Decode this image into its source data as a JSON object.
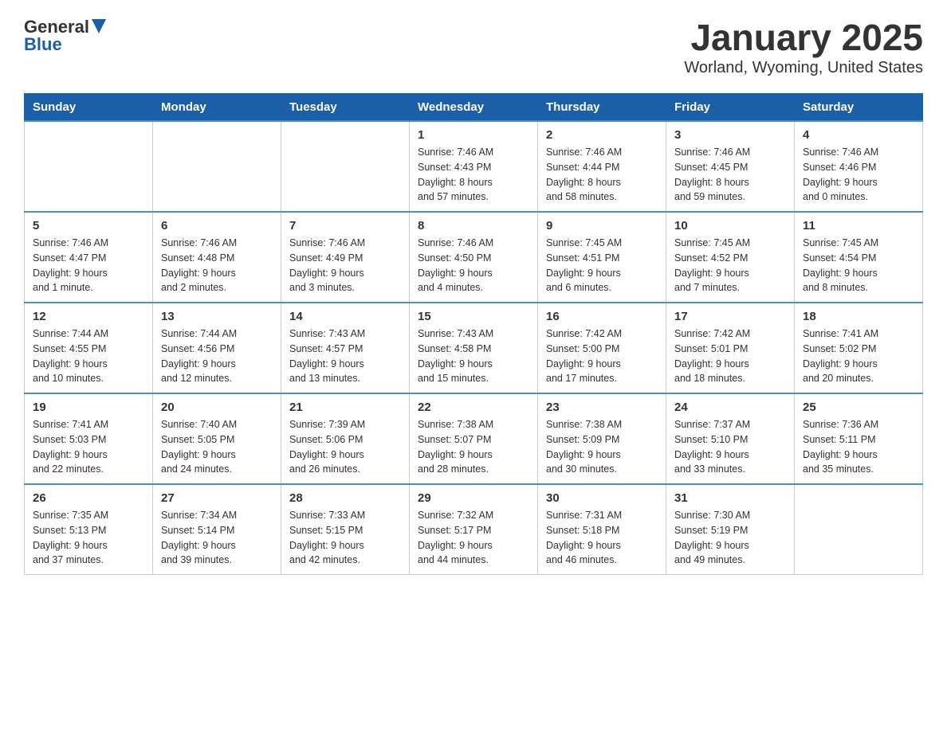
{
  "logo": {
    "general": "General",
    "blue": "Blue"
  },
  "title": "January 2025",
  "subtitle": "Worland, Wyoming, United States",
  "days_of_week": [
    "Sunday",
    "Monday",
    "Tuesday",
    "Wednesday",
    "Thursday",
    "Friday",
    "Saturday"
  ],
  "weeks": [
    [
      {
        "day": "",
        "info": ""
      },
      {
        "day": "",
        "info": ""
      },
      {
        "day": "",
        "info": ""
      },
      {
        "day": "1",
        "info": "Sunrise: 7:46 AM\nSunset: 4:43 PM\nDaylight: 8 hours\nand 57 minutes."
      },
      {
        "day": "2",
        "info": "Sunrise: 7:46 AM\nSunset: 4:44 PM\nDaylight: 8 hours\nand 58 minutes."
      },
      {
        "day": "3",
        "info": "Sunrise: 7:46 AM\nSunset: 4:45 PM\nDaylight: 8 hours\nand 59 minutes."
      },
      {
        "day": "4",
        "info": "Sunrise: 7:46 AM\nSunset: 4:46 PM\nDaylight: 9 hours\nand 0 minutes."
      }
    ],
    [
      {
        "day": "5",
        "info": "Sunrise: 7:46 AM\nSunset: 4:47 PM\nDaylight: 9 hours\nand 1 minute."
      },
      {
        "day": "6",
        "info": "Sunrise: 7:46 AM\nSunset: 4:48 PM\nDaylight: 9 hours\nand 2 minutes."
      },
      {
        "day": "7",
        "info": "Sunrise: 7:46 AM\nSunset: 4:49 PM\nDaylight: 9 hours\nand 3 minutes."
      },
      {
        "day": "8",
        "info": "Sunrise: 7:46 AM\nSunset: 4:50 PM\nDaylight: 9 hours\nand 4 minutes."
      },
      {
        "day": "9",
        "info": "Sunrise: 7:45 AM\nSunset: 4:51 PM\nDaylight: 9 hours\nand 6 minutes."
      },
      {
        "day": "10",
        "info": "Sunrise: 7:45 AM\nSunset: 4:52 PM\nDaylight: 9 hours\nand 7 minutes."
      },
      {
        "day": "11",
        "info": "Sunrise: 7:45 AM\nSunset: 4:54 PM\nDaylight: 9 hours\nand 8 minutes."
      }
    ],
    [
      {
        "day": "12",
        "info": "Sunrise: 7:44 AM\nSunset: 4:55 PM\nDaylight: 9 hours\nand 10 minutes."
      },
      {
        "day": "13",
        "info": "Sunrise: 7:44 AM\nSunset: 4:56 PM\nDaylight: 9 hours\nand 12 minutes."
      },
      {
        "day": "14",
        "info": "Sunrise: 7:43 AM\nSunset: 4:57 PM\nDaylight: 9 hours\nand 13 minutes."
      },
      {
        "day": "15",
        "info": "Sunrise: 7:43 AM\nSunset: 4:58 PM\nDaylight: 9 hours\nand 15 minutes."
      },
      {
        "day": "16",
        "info": "Sunrise: 7:42 AM\nSunset: 5:00 PM\nDaylight: 9 hours\nand 17 minutes."
      },
      {
        "day": "17",
        "info": "Sunrise: 7:42 AM\nSunset: 5:01 PM\nDaylight: 9 hours\nand 18 minutes."
      },
      {
        "day": "18",
        "info": "Sunrise: 7:41 AM\nSunset: 5:02 PM\nDaylight: 9 hours\nand 20 minutes."
      }
    ],
    [
      {
        "day": "19",
        "info": "Sunrise: 7:41 AM\nSunset: 5:03 PM\nDaylight: 9 hours\nand 22 minutes."
      },
      {
        "day": "20",
        "info": "Sunrise: 7:40 AM\nSunset: 5:05 PM\nDaylight: 9 hours\nand 24 minutes."
      },
      {
        "day": "21",
        "info": "Sunrise: 7:39 AM\nSunset: 5:06 PM\nDaylight: 9 hours\nand 26 minutes."
      },
      {
        "day": "22",
        "info": "Sunrise: 7:38 AM\nSunset: 5:07 PM\nDaylight: 9 hours\nand 28 minutes."
      },
      {
        "day": "23",
        "info": "Sunrise: 7:38 AM\nSunset: 5:09 PM\nDaylight: 9 hours\nand 30 minutes."
      },
      {
        "day": "24",
        "info": "Sunrise: 7:37 AM\nSunset: 5:10 PM\nDaylight: 9 hours\nand 33 minutes."
      },
      {
        "day": "25",
        "info": "Sunrise: 7:36 AM\nSunset: 5:11 PM\nDaylight: 9 hours\nand 35 minutes."
      }
    ],
    [
      {
        "day": "26",
        "info": "Sunrise: 7:35 AM\nSunset: 5:13 PM\nDaylight: 9 hours\nand 37 minutes."
      },
      {
        "day": "27",
        "info": "Sunrise: 7:34 AM\nSunset: 5:14 PM\nDaylight: 9 hours\nand 39 minutes."
      },
      {
        "day": "28",
        "info": "Sunrise: 7:33 AM\nSunset: 5:15 PM\nDaylight: 9 hours\nand 42 minutes."
      },
      {
        "day": "29",
        "info": "Sunrise: 7:32 AM\nSunset: 5:17 PM\nDaylight: 9 hours\nand 44 minutes."
      },
      {
        "day": "30",
        "info": "Sunrise: 7:31 AM\nSunset: 5:18 PM\nDaylight: 9 hours\nand 46 minutes."
      },
      {
        "day": "31",
        "info": "Sunrise: 7:30 AM\nSunset: 5:19 PM\nDaylight: 9 hours\nand 49 minutes."
      },
      {
        "day": "",
        "info": ""
      }
    ]
  ]
}
